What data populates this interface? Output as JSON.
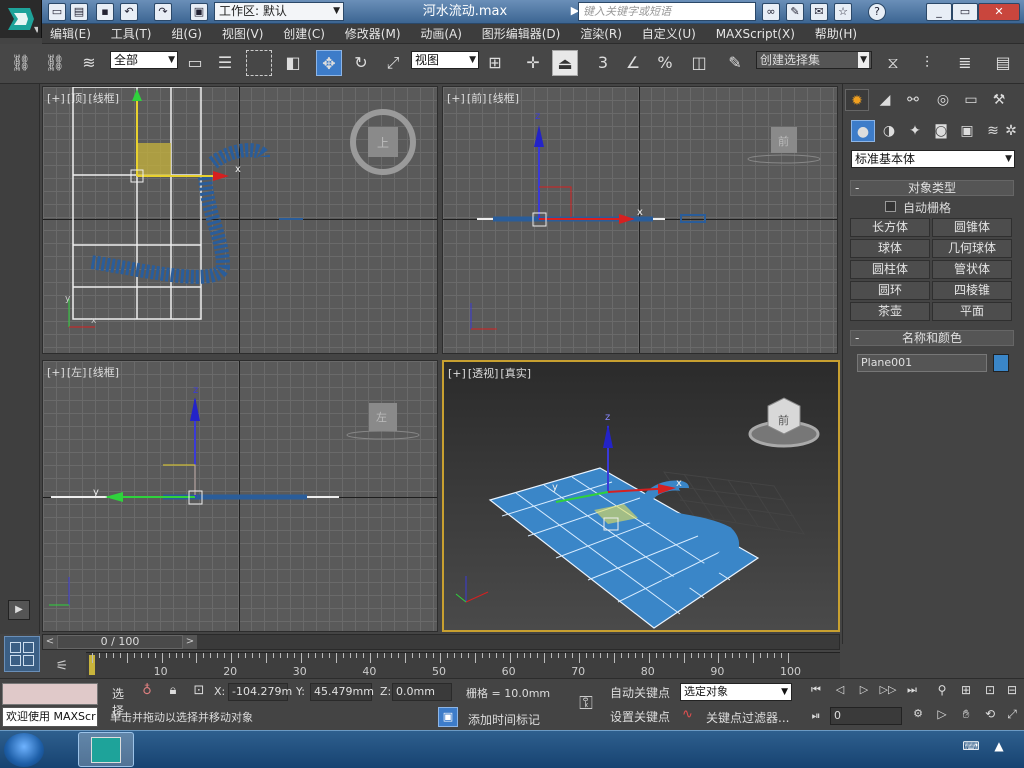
{
  "window": {
    "workspace_label": "工作区: 默认",
    "filename": "河水流动.max",
    "search_placeholder": "键入关键字或短语"
  },
  "menu": [
    "编辑(E)",
    "工具(T)",
    "组(G)",
    "视图(V)",
    "创建(C)",
    "修改器(M)",
    "动画(A)",
    "图形编辑器(D)",
    "渲染(R)",
    "自定义(U)",
    "MAXScript(X)",
    "帮助(H)"
  ],
  "toolbar": {
    "selection_filter": "全部",
    "ref_coord": "视图",
    "named_selection": "创建选择集",
    "snap_3": "3",
    "percent": "%"
  },
  "viewports": {
    "top": {
      "plus": "[+]",
      "name": "[顶]",
      "mode": "[线框]",
      "cube": "上"
    },
    "front": {
      "plus": "[+]",
      "name": "[前]",
      "mode": "[线框]",
      "cube": "前"
    },
    "left": {
      "plus": "[+]",
      "name": "[左]",
      "mode": "[线框]",
      "cube": "左"
    },
    "persp": {
      "plus": "[+]",
      "name": "[透视]",
      "mode": "[真实]",
      "cube": "前"
    }
  },
  "axis_labels": {
    "x": "x",
    "y": "y",
    "z": "z"
  },
  "command_panel": {
    "category": "标准基本体",
    "object_type_title": "对象类型",
    "autogrid_label": "自动栅格",
    "buttons": [
      "长方体",
      "圆锥体",
      "球体",
      "几何球体",
      "圆柱体",
      "管状体",
      "圆环",
      "四棱锥",
      "茶壶",
      "平面"
    ],
    "name_color_title": "名称和颜色",
    "object_name": "Plane001",
    "object_color": "#3a86c8"
  },
  "timeline": {
    "frame_display": "0 / 100",
    "ticks": [
      "0",
      "10",
      "20",
      "30",
      "40",
      "50",
      "60",
      "70",
      "80",
      "90",
      "100"
    ]
  },
  "status": {
    "welcome": "欢迎使用 MAXScr",
    "select_label": "选择",
    "prompt": "单击并拖动以选择并移动对象",
    "x_label": "X:",
    "x_value": "-104.279m",
    "y_label": "Y:",
    "y_value": "45.479mm",
    "z_label": "Z:",
    "z_value": "0.0mm",
    "grid_label": "栅格 = 10.0mm",
    "add_time_tag": "添加时间标记",
    "auto_key": "自动关键点",
    "set_key": "设置关键点",
    "key_mode": "选定对象",
    "key_filter": "关键点过滤器...",
    "frame_field": "0"
  },
  "colors": {
    "selected_blue": "#3a86c8",
    "active_border": "#c8a030"
  }
}
